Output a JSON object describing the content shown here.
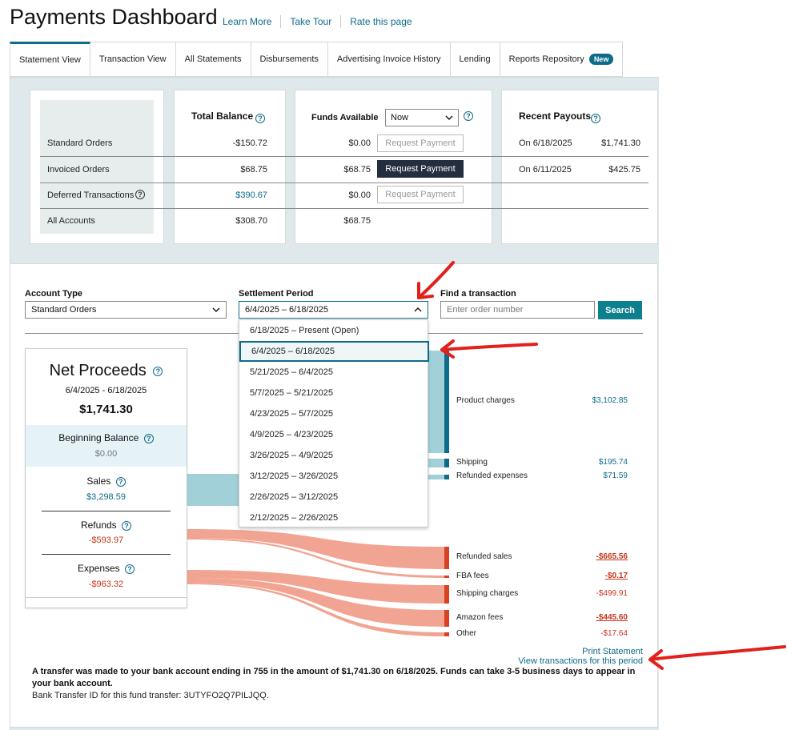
{
  "header": {
    "title": "Payments Dashboard",
    "links": [
      "Learn More",
      "Take Tour",
      "Rate this page"
    ]
  },
  "tabs": [
    {
      "label": "Statement View",
      "active": true
    },
    {
      "label": "Transaction View"
    },
    {
      "label": "All Statements"
    },
    {
      "label": "Disbursements"
    },
    {
      "label": "Advertising Invoice History"
    },
    {
      "label": "Lending"
    },
    {
      "label": "Reports Repository",
      "badge": "New"
    }
  ],
  "summary": {
    "row_labels": [
      "Standard Orders",
      "Invoiced Orders",
      "Deferred Transactions",
      "All Accounts"
    ],
    "total_balance": {
      "title": "Total Balance",
      "values": [
        "-$150.72",
        "$68.75",
        "$390.67",
        "$308.70"
      ]
    },
    "funds_available": {
      "title": "Funds Available",
      "select_value": "Now",
      "values": [
        "$0.00",
        "$68.75",
        "$0.00",
        "$68.75"
      ],
      "button_label": "Request Payment"
    },
    "recent_payouts": {
      "title": "Recent Payouts",
      "rows": [
        {
          "date": "On 6/18/2025",
          "amount": "$1,741.30"
        },
        {
          "date": "On 6/11/2025",
          "amount": "$425.75"
        }
      ]
    }
  },
  "filters": {
    "account_type_label": "Account Type",
    "account_type_value": "Standard Orders",
    "settlement_label": "Settlement Period",
    "settlement_value": "6/4/2025 – 6/18/2025",
    "find_label": "Find a transaction",
    "find_placeholder": "Enter order number",
    "search_button": "Search"
  },
  "settlement_options": [
    "6/18/2025 – Present (Open)",
    "6/4/2025 – 6/18/2025",
    "5/21/2025 – 6/4/2025",
    "5/7/2025 – 5/21/2025",
    "4/23/2025 – 5/7/2025",
    "4/9/2025 – 4/23/2025",
    "3/26/2025 – 4/9/2025",
    "3/12/2025 – 3/26/2025",
    "2/26/2025 – 3/12/2025",
    "2/12/2025 – 2/26/2025"
  ],
  "net_proceeds": {
    "title": "Net Proceeds",
    "period": "6/4/2025 - 6/18/2025",
    "amount": "$1,741.30",
    "beginning_balance_label": "Beginning Balance",
    "beginning_balance": "$0.00",
    "sales_label": "Sales",
    "sales": "$3,298.59",
    "refunds_label": "Refunds",
    "refunds": "-$593.97",
    "expenses_label": "Expenses",
    "expenses": "-$963.32"
  },
  "breakdown": {
    "product_charges": {
      "label": "Product charges",
      "value": "$3,102.85"
    },
    "shipping": {
      "label": "Shipping",
      "value": "$195.74"
    },
    "refunded_expenses": {
      "label": "Refunded expenses",
      "value": "$71.59"
    },
    "refunded_sales": {
      "label": "Refunded sales",
      "value": "-$665.56"
    },
    "fba_fees": {
      "label": "FBA fees",
      "value": "-$0.17"
    },
    "shipping_charges": {
      "label": "Shipping charges",
      "value": "-$499.91"
    },
    "amazon_fees": {
      "label": "Amazon fees",
      "value": "-$445.60"
    },
    "other": {
      "label": "Other",
      "value": "-$17.64"
    }
  },
  "links": {
    "print_statement": "Print Statement",
    "view_transactions": "View transactions for this period"
  },
  "transfer": {
    "message": "A transfer was made to your bank account ending in 755 in the amount of $1,741.30 on 6/18/2025. Funds can take 3-5 business days to appear in your bank account.",
    "id_text": "Bank Transfer ID for this fund transfer: 3UTYFO2Q7PILJQQ."
  },
  "colors": {
    "accent": "#0e6b8a",
    "positive_flow": "#a2d0d9",
    "negative_flow": "#f2a492",
    "annotation_arrow": "#e2201c"
  }
}
